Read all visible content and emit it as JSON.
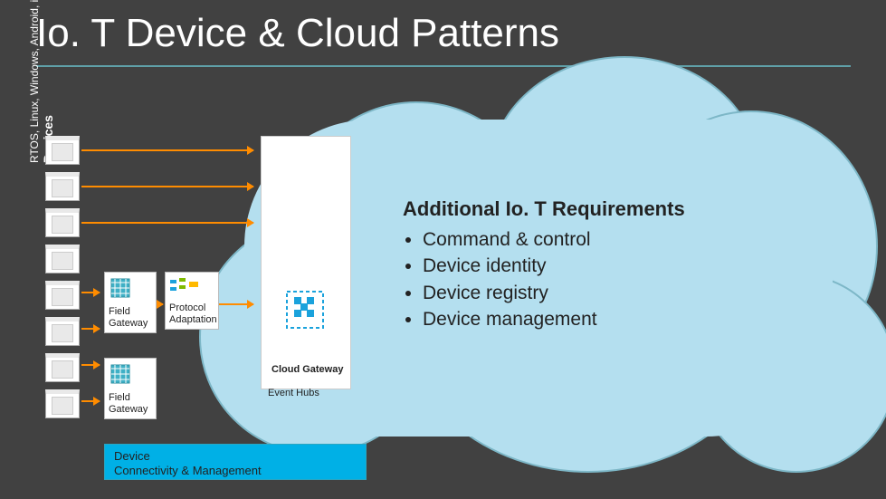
{
  "title": "Io. T Device & Cloud Patterns",
  "devices_label": {
    "heading": "Devices",
    "sub": "RTOS, Linux, Windows, Android, i. OS"
  },
  "field_gateway_1": "Field Gateway",
  "protocol_adaptation": "Protocol Adaptation",
  "field_gateway_2": "Field Gateway",
  "cloud_gateway": "Cloud Gateway",
  "event_hubs": "Event Hubs",
  "requirements": {
    "heading": "Additional Io. T Requirements",
    "items": [
      "Command & control",
      "Device identity",
      "Device registry",
      "Device management"
    ]
  },
  "bottom_bar": {
    "line1": "Device",
    "line2": "Connectivity & Management"
  }
}
